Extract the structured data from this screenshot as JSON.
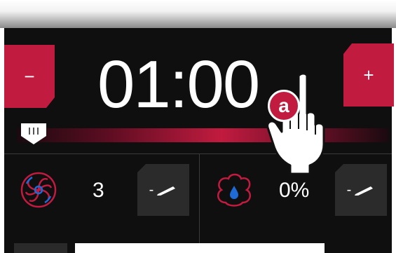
{
  "controls": {
    "minus_label": "−",
    "plus_label": "+",
    "timer_value": "01:00"
  },
  "settings": {
    "fan_level": "3",
    "moisture_percent": "0%",
    "edit_label": "-"
  },
  "overlay": {
    "badge_letter": "a"
  },
  "colors": {
    "accent": "#c11b3f",
    "panel_bg": "#0f0f0f",
    "button_dark": "#2b2b2b",
    "fan_icon_blue": "#1e6bd6"
  },
  "icons": {
    "fan": "fan-icon",
    "moisture": "moisture-icon",
    "edit": "pencil-icon",
    "pointer": "pointing-hand-icon"
  }
}
